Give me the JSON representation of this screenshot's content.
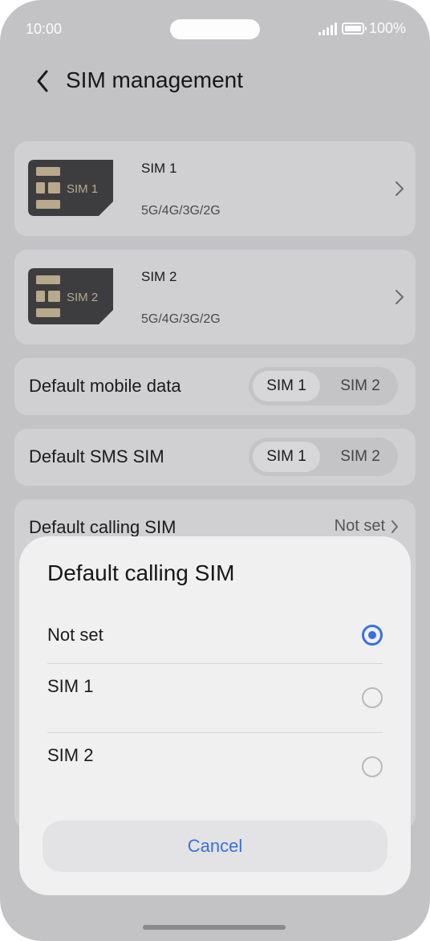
{
  "status_bar": {
    "time": "10:00",
    "battery": "100%"
  },
  "header": {
    "title": "SIM management",
    "back_icon": "chevron-left-icon"
  },
  "sims": [
    {
      "card_label": "SIM 1",
      "name": "SIM 1",
      "network": "5G/4G/3G/2G"
    },
    {
      "card_label": "SIM 2",
      "name": "SIM 2",
      "network": "5G/4G/3G/2G"
    }
  ],
  "settings": {
    "mobile_data": {
      "label": "Default mobile data",
      "options": [
        "SIM 1",
        "SIM 2"
      ],
      "selected": "SIM 1"
    },
    "sms": {
      "label": "Default SMS SIM",
      "options": [
        "SIM 1",
        "SIM 2"
      ],
      "selected": "SIM 1"
    },
    "calling": {
      "label": "Default calling SIM",
      "value": "Not set"
    }
  },
  "dialog": {
    "title": "Default calling SIM",
    "options": [
      {
        "label": "Not set",
        "selected": true
      },
      {
        "label": "SIM 1",
        "selected": false
      },
      {
        "label": "SIM 2",
        "selected": false
      }
    ],
    "cancel_label": "Cancel"
  },
  "colors": {
    "accent": "#3a6fe0",
    "sim_card": "#3d3d3f",
    "sim_chip": "#b8a98c"
  }
}
